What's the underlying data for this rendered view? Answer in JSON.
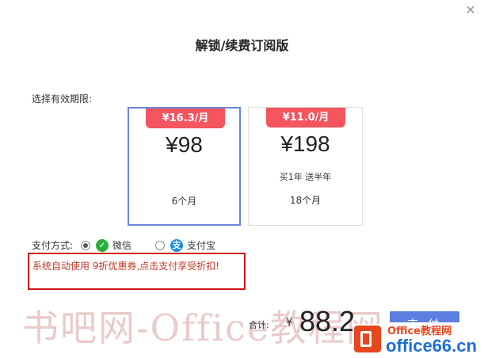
{
  "dialog": {
    "title": "解锁/续费订阅版",
    "close_icon": "close-icon"
  },
  "plans_section": {
    "label": "选择有效期限:"
  },
  "plans": [
    {
      "badge": "¥16.3/月",
      "price": "¥98",
      "bonus": "",
      "duration": "6个月",
      "selected": true
    },
    {
      "badge": "¥11.0/月",
      "price": "¥198",
      "bonus": "买1年 送半年",
      "duration": "18个月",
      "selected": false
    }
  ],
  "payment": {
    "label": "支付方式:",
    "options": [
      {
        "label": "微信",
        "icon": "wechat-icon",
        "checked": true
      },
      {
        "label": "支付宝",
        "icon": "alipay-icon",
        "checked": false
      }
    ]
  },
  "notice": {
    "text": "系统自动使用 9折优惠券,点击支付享受折扣!"
  },
  "total": {
    "label": "合计:",
    "currency": "¥",
    "amount": "88.2"
  },
  "pay_button": {
    "label": "支付"
  },
  "watermark": {
    "text": "书吧网-Office教程网"
  },
  "brand": {
    "top": "Office教程网",
    "main": "office66.cn"
  },
  "colors": {
    "badge": "#f4555f",
    "selected_border": "#6b86d8",
    "pay_button": "#5b7fe0",
    "notice_border": "#d0141b",
    "notice_text": "#c0392b"
  }
}
